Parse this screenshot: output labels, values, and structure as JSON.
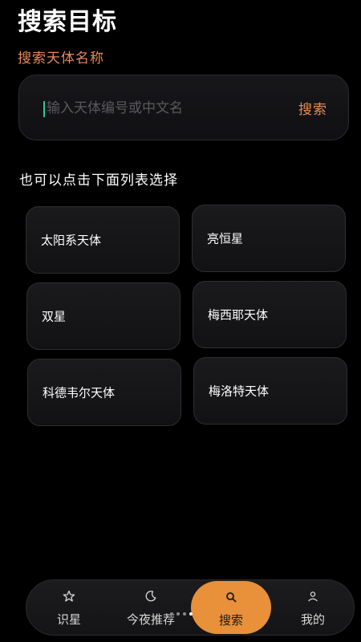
{
  "header": {
    "title": "搜索目标"
  },
  "search": {
    "section_label": "搜索天体名称",
    "placeholder": "输入天体编号或中文名",
    "button_label": "搜索"
  },
  "list": {
    "hint": "也可以点击下面列表选择",
    "items": [
      {
        "label": "太阳系天体"
      },
      {
        "label": "亮恒星"
      },
      {
        "label": "双星"
      },
      {
        "label": "梅西耶天体"
      },
      {
        "label": "科德韦尔天体"
      },
      {
        "label": "梅洛特天体"
      }
    ]
  },
  "bottom_nav": {
    "items": [
      {
        "label": "识星",
        "icon": "star-icon"
      },
      {
        "label": "今夜推荐",
        "icon": "moon-icon"
      },
      {
        "label": "搜索",
        "icon": "search-icon",
        "active": true
      },
      {
        "label": "我的",
        "icon": "user-icon"
      }
    ]
  },
  "colors": {
    "background": "#000000",
    "accent": "#e8895a",
    "active_tab": "#e8903a",
    "cursor": "#2ec98f"
  }
}
